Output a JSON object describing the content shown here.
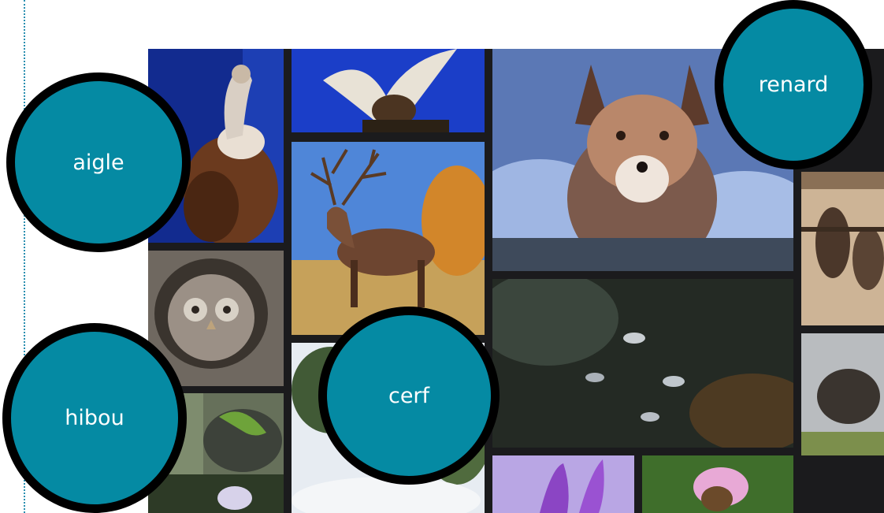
{
  "labels": {
    "eagle": "aigle",
    "fox": "renard",
    "owl": "hibou",
    "deer": "cerf"
  },
  "colors": {
    "label_fill": "#058aa3",
    "label_border": "#000000",
    "label_text": "#ffffff",
    "guide_line": "#2a8fb0"
  },
  "collage": {
    "tiles": [
      "vulture-photo",
      "eagle-flight-photo",
      "fox-photo",
      "stag-photo",
      "owl-photo",
      "bats-photo",
      "lizard-photo",
      "water-insects-photo",
      "beetle-photo",
      "snow-scene-photo",
      "crocus-photo",
      "orchid-photo",
      "flower-photo"
    ]
  }
}
